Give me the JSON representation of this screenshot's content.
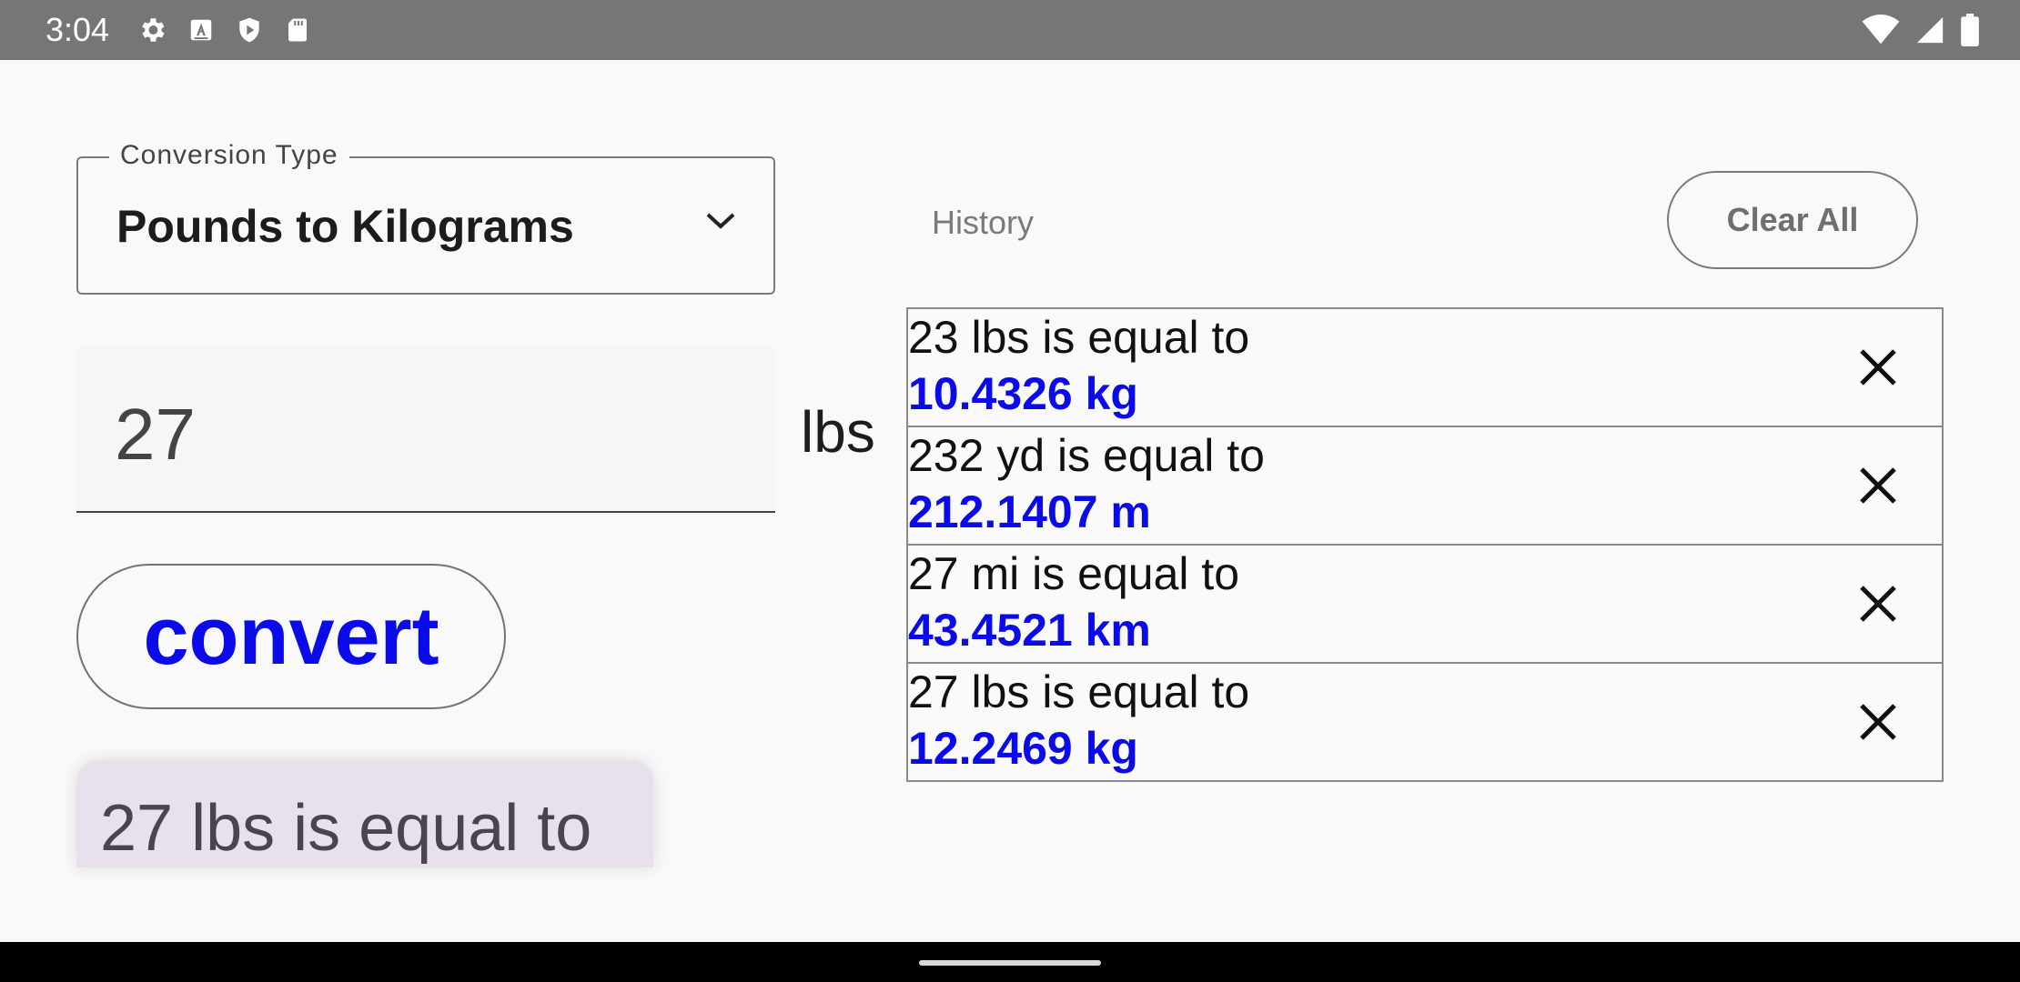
{
  "status_bar": {
    "time": "3:04",
    "left_icons": [
      "settings-icon",
      "text-a-icon",
      "shield-play-icon",
      "sd-card-icon"
    ],
    "right_icons": [
      "wifi-icon",
      "cell-signal-icon",
      "battery-icon"
    ]
  },
  "converter": {
    "type_label": "Conversion Type",
    "type_value": "Pounds to Kilograms",
    "input_value": "27",
    "unit": "lbs",
    "convert_label": "convert",
    "result_text": "27 lbs is equal to"
  },
  "history": {
    "title": "History",
    "clear_label": "Clear All",
    "items": [
      {
        "question": "23 lbs is equal to",
        "answer": "10.4326 kg"
      },
      {
        "question": "232 yd is equal to",
        "answer": "212.1407 m"
      },
      {
        "question": "27 mi is equal to",
        "answer": "43.4521 km"
      },
      {
        "question": "27 lbs is equal to",
        "answer": "12.2469 kg"
      }
    ]
  },
  "colors": {
    "accent_blue": "#0b0bea",
    "status_bar": "#767676",
    "result_card": "#e8e0ec"
  }
}
